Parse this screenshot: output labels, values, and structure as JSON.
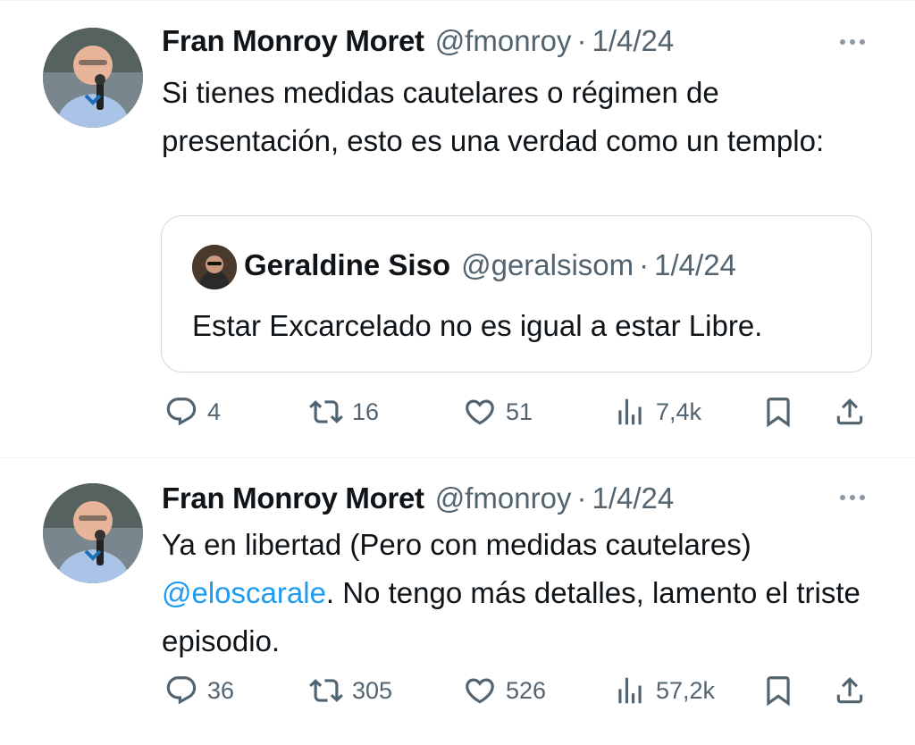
{
  "tweets": [
    {
      "author_name": "Fran Monroy Moret",
      "author_handle": "@fmonroy",
      "separator": "·",
      "date": "1/4/24",
      "text": "Si tienes medidas cautelares o régimen de presentación, esto es una verdad como un templo:",
      "quote": {
        "author_name": "Geraldine Siso",
        "author_handle": "@geralsisom",
        "separator": "·",
        "date": "1/4/24",
        "text": "Estar Excarcelado no es igual a estar Libre."
      },
      "counts": {
        "replies": "4",
        "retweets": "16",
        "likes": "51",
        "views": "7,4k"
      }
    },
    {
      "author_name": "Fran Monroy Moret",
      "author_handle": "@fmonroy",
      "separator": "·",
      "date": "1/4/24",
      "text_before_mention": "Ya en libertad (Pero con medidas cautelares)",
      "mention": "@eloscarale",
      "text_after_mention": ". No tengo más detalles, lamento el triste episodio.",
      "counts": {
        "replies": "36",
        "retweets": "305",
        "likes": "526",
        "views": "57,2k"
      }
    }
  ],
  "icons": [
    "reply-icon",
    "retweet-icon",
    "like-icon",
    "views-icon",
    "bookmark-icon",
    "share-icon",
    "more-icon"
  ],
  "colors": {
    "text": "#0f1419",
    "secondary": "#536471",
    "link": "#1d9bf0",
    "border": "#cfd9de"
  }
}
